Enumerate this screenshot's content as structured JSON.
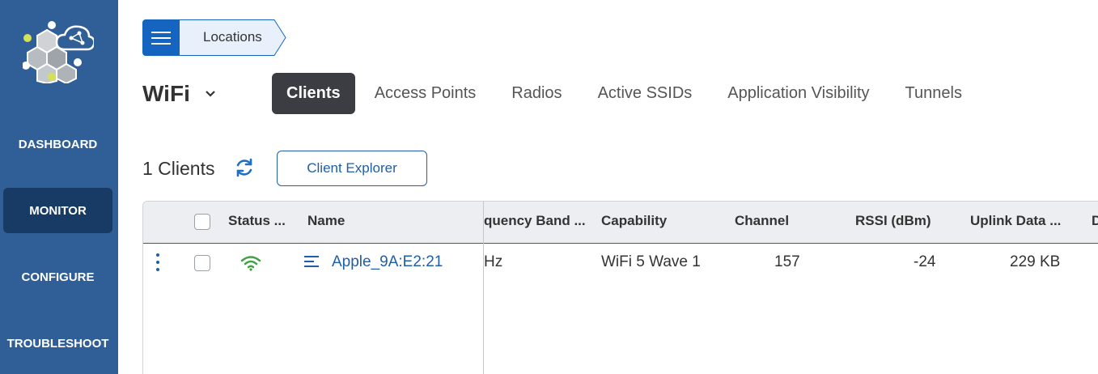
{
  "sidebar": {
    "items": [
      {
        "label": "DASHBOARD",
        "active": false
      },
      {
        "label": "MONITOR",
        "active": true
      },
      {
        "label": "CONFIGURE",
        "active": false
      },
      {
        "label": "TROUBLESHOOT",
        "active": false
      }
    ]
  },
  "breadcrumb": {
    "label": "Locations"
  },
  "page": {
    "title": "WiFi"
  },
  "tabs": [
    {
      "label": "Clients",
      "active": true
    },
    {
      "label": "Access Points"
    },
    {
      "label": "Radios"
    },
    {
      "label": "Active SSIDs"
    },
    {
      "label": "Application Visibility"
    },
    {
      "label": "Tunnels"
    }
  ],
  "summary": {
    "count_label": "1 Clients",
    "explorer_button": "Client Explorer"
  },
  "table": {
    "headers": {
      "status": "Status ...",
      "name": "Name",
      "frequency_band": "quency Band ...",
      "capability": "Capability",
      "channel": "Channel",
      "rssi": "RSSI (dBm)",
      "uplink": "Uplink Data ...",
      "next": "D"
    },
    "rows": [
      {
        "status": "connected",
        "name": "Apple_9A:E2:21",
        "frequency_band": "Hz",
        "capability": "WiFi 5 Wave 1",
        "channel": "157",
        "rssi": "-24",
        "uplink": "229 KB"
      }
    ]
  },
  "colors": {
    "sidebar_bg": "#2f5f96",
    "sidebar_active": "#183b66",
    "accent_blue": "#1565c0",
    "status_green": "#43a047",
    "tab_active_bg": "#3b3d42"
  }
}
